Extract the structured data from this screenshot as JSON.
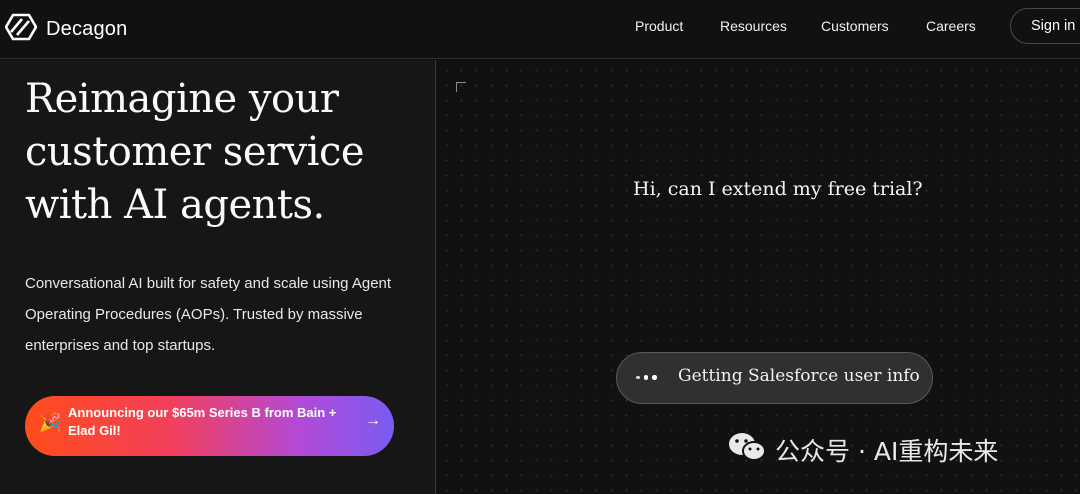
{
  "nav": {
    "brand": "Decagon",
    "links": [
      "Product",
      "Resources",
      "Customers",
      "Careers"
    ],
    "signin": "Sign in"
  },
  "hero": {
    "headline": "Reimagine your customer service with AI agents.",
    "subtext": "Conversational AI built for safety and scale using Agent Operating Procedures (AOPs). Trusted by massive enterprises and top startups.",
    "announcement": "Announcing our $65m Series B from Bain + Elad Gil!",
    "announcement_icon": "party-popper-icon",
    "arrow_icon": "arrow-right-icon"
  },
  "demo": {
    "user_message": "Hi, can I extend my free trial?",
    "status": "Getting Salesforce user info"
  },
  "watermark": "公众号 · AI重构未来",
  "colors": {
    "background": "#121212",
    "announcement_gradient": [
      "#ff4d1a",
      "#f23f5c",
      "#b24ad8",
      "#7a5cf0"
    ]
  }
}
